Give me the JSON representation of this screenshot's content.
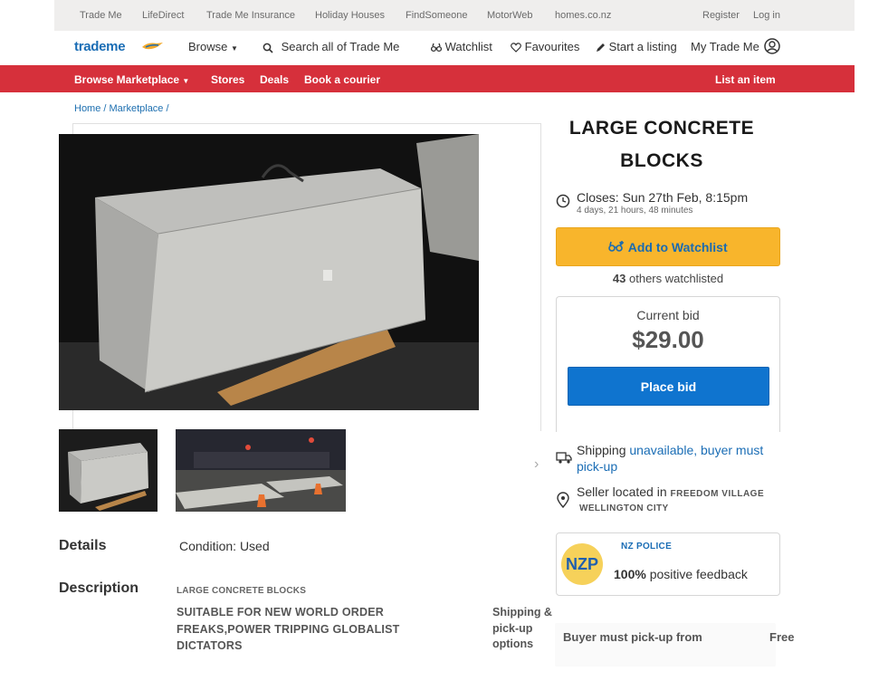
{
  "top_links": [
    "Trade Me",
    "LifeDirect",
    "Trade Me Insurance",
    "Holiday Houses",
    "FindSomeone",
    "MotorWeb",
    "homes.co.nz"
  ],
  "account_links": {
    "register": "Register",
    "login": "Log in"
  },
  "header": {
    "logo": "trademe",
    "browse": "Browse",
    "search_placeholder": "Search all of Trade Me",
    "watchlist": "Watchlist",
    "favourites": "Favourites",
    "start_listing": "Start a listing",
    "my_trade_me": "My Trade Me"
  },
  "red_nav": {
    "browse_marketplace": "Browse Marketplace",
    "stores": "Stores",
    "deals": "Deals",
    "book_courier": "Book a courier",
    "list_item": "List an item"
  },
  "breadcrumb": "Home / Marketplace /",
  "listing": {
    "title": "LARGE CONCRETE BLOCKS",
    "closes": "Closes: Sun 27th Feb, 8:15pm",
    "closes_remaining": "4 days, 21 hours, 48 minutes",
    "watch_button": "Add to Watchlist",
    "watch_count": "43",
    "watch_count_suffix": " others watchlisted",
    "bid_label": "Current bid",
    "bid_amount": "$29.00",
    "bid_button": "Place bid",
    "shipping_prefix": "Shipping ",
    "shipping_status": "unavailable, buyer must pick-up",
    "seller_prefix": "Seller located in ",
    "seller_suburb": "FREEDOM VILLAGE",
    "seller_city": "WELLINGTON CITY",
    "seller_avatar": "NZP",
    "seller_name": "NZ POLICE",
    "feedback_pct": "100%",
    "feedback_suffix": " positive feedback"
  },
  "details": {
    "details_heading": "Details",
    "condition_label": "Condition:",
    "condition_value": "Used",
    "description_heading": "Description",
    "description_title": "LARGE CONCRETE BLOCKS",
    "description_body": "SUITABLE FOR NEW WORLD ORDER FREAKS,POWER TRIPPING GLOBALIST DICTATORS",
    "shipping_options_label": "Shipping & pick-up options",
    "shipping_option": "Buyer must pick-up from",
    "shipping_price": "Free"
  },
  "colors": {
    "red_nav": "#d6303b",
    "watch_yellow": "#f8b52c",
    "bid_blue": "#0f74cf",
    "link_blue": "#1a6db5"
  }
}
